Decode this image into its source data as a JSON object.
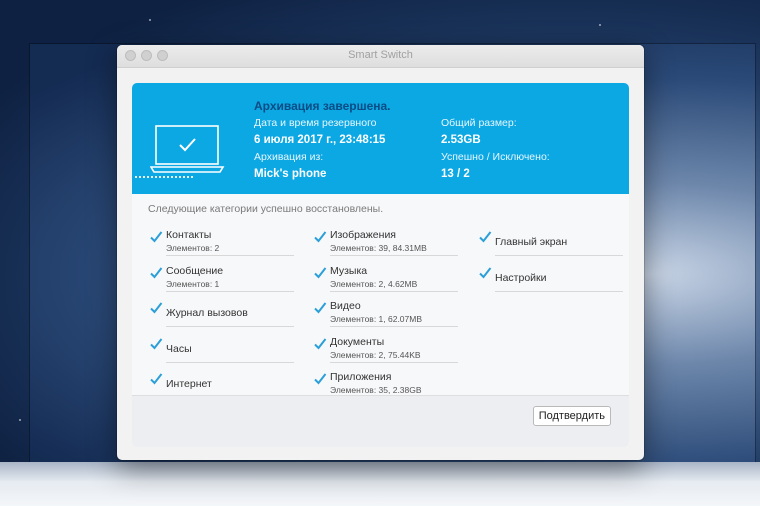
{
  "window": {
    "title": "Smart Switch"
  },
  "banner": {
    "status": "Архивация завершена.",
    "date_label": "Дата и время резервного",
    "date_value": "6 июля 2017 г., 23:48:15",
    "source_label": "Архивация из:",
    "source_value": "Mick's phone",
    "size_label": "Общий размер:",
    "size_value": "2.53GB",
    "result_label": "Успешно / Исключено:",
    "result_value": "13 / 2"
  },
  "restored": {
    "subtitle": "Следующие категории успешно восстановлены.",
    "col1": [
      {
        "name": "Контакты",
        "detail": "Элементов: 2"
      },
      {
        "name": "Сообщение",
        "detail": "Элементов: 1"
      },
      {
        "name": "Журнал вызовов",
        "detail": ""
      },
      {
        "name": "Часы",
        "detail": ""
      },
      {
        "name": "Интернет",
        "detail": ""
      }
    ],
    "col2": [
      {
        "name": "Изображения",
        "detail": "Элементов: 39, 84.31MB"
      },
      {
        "name": "Музыка",
        "detail": "Элементов: 2, 4.62MB"
      },
      {
        "name": "Видео",
        "detail": "Элементов: 1, 62.07MB"
      },
      {
        "name": "Документы",
        "detail": "Элементов: 2, 75.44KB"
      },
      {
        "name": "Приложения",
        "detail": "Элементов: 35, 2.38GB"
      }
    ],
    "col3": [
      {
        "name": "Главный экран",
        "detail": ""
      },
      {
        "name": "Настройки",
        "detail": ""
      }
    ]
  },
  "footer": {
    "confirm_label": "Подтвердить"
  },
  "colors": {
    "accent": "#0ca8e4",
    "check": "#2b9fd8",
    "status_text": "#0b4c84"
  },
  "icons": {
    "check": "checkmark-icon",
    "laptop": "laptop-icon"
  }
}
